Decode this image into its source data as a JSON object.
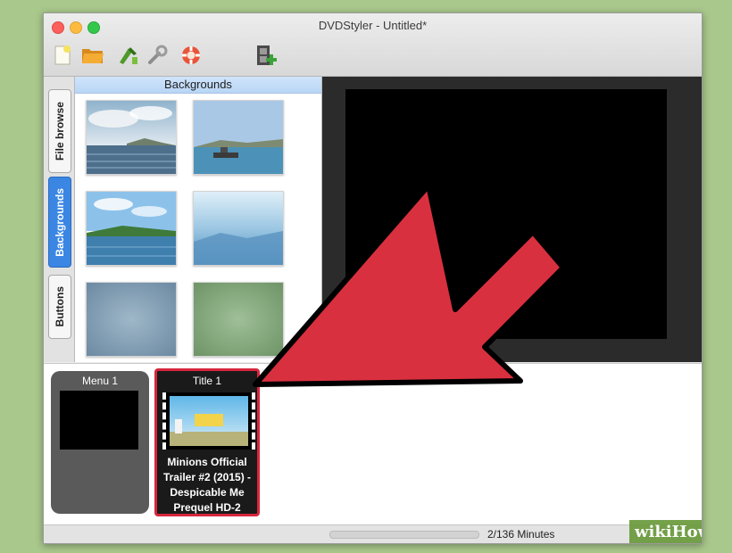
{
  "window": {
    "title": "DVDStyler - Untitled*"
  },
  "toolbar": {
    "items": [
      {
        "name": "new-project-icon"
      },
      {
        "name": "open-folder-icon"
      },
      {
        "name": "burn-dvd-icon"
      },
      {
        "name": "settings-wrench-icon"
      },
      {
        "name": "help-lifebuoy-icon"
      },
      {
        "name": "add-title-film-icon"
      }
    ]
  },
  "tabs": {
    "file_browse": "File browse",
    "backgrounds": "Backgrounds",
    "buttons": "Buttons"
  },
  "backgrounds_panel": {
    "header": "Backgrounds",
    "thumbnails": [
      "sea-cloudy-sky",
      "ship-on-sea",
      "coastline-island",
      "blue-haze",
      "blue-fog",
      "green-fog"
    ]
  },
  "menus": {
    "menu1_label": "Menu 1",
    "title1_label": "Title 1",
    "title1_clip_name": "Minions Official Trailer #2 (2015) - Despicable Me Prequel HD-2"
  },
  "status": {
    "duration_text": "2/136 Minutes",
    "progress": 0.015
  },
  "watermark": {
    "text": "wikiHow"
  },
  "colors": {
    "accent_blue": "#3b86e3",
    "highlight_red": "#d7263d",
    "arrow_red": "#d9303f"
  }
}
